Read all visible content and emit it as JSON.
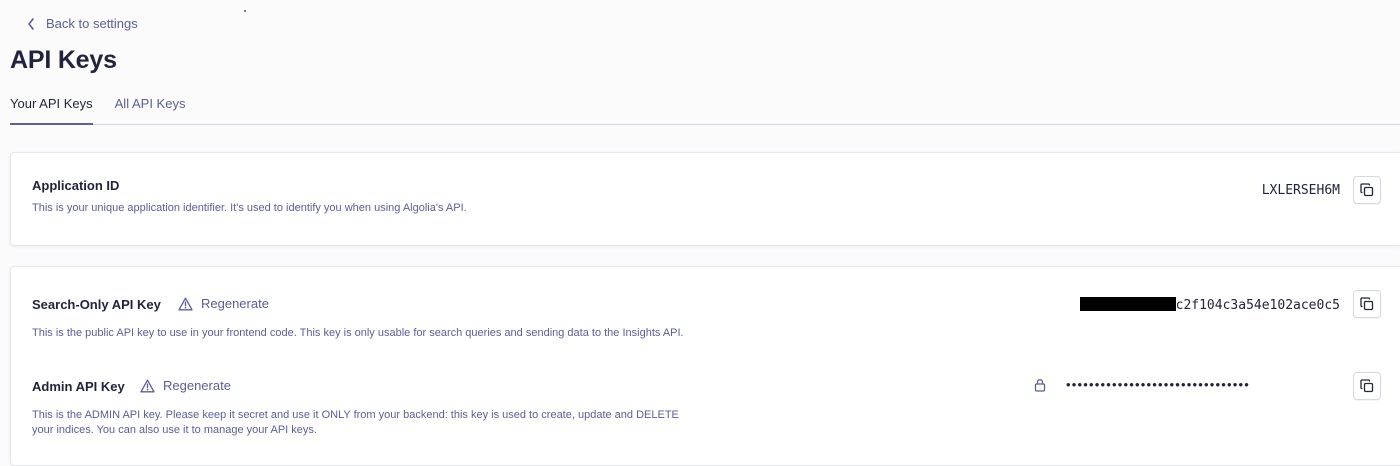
{
  "nav": {
    "back_label": "Back to settings"
  },
  "page": {
    "title": "API Keys"
  },
  "tabs": [
    {
      "label": "Your API Keys",
      "active": true
    },
    {
      "label": "All API Keys",
      "active": false
    }
  ],
  "application": {
    "label": "Application ID",
    "description": "This is your unique application identifier. It's used to identify you when using Algolia's API.",
    "value": "LXLERSEH6M"
  },
  "search_key": {
    "label": "Search-Only API Key",
    "regenerate_label": "Regenerate",
    "description": "This is the public API key to use in your frontend code. This key is only usable for search queries and sending data to the Insights API.",
    "value_visible": "c2f104c3a54e102ace0c5"
  },
  "admin_key": {
    "label": "Admin API Key",
    "regenerate_label": "Regenerate",
    "description_line1": "This is the ADMIN API key. Please keep it secret and use it ONLY from your backend: this key is used to create, update and DELETE",
    "description_line2": "your indices. You can also use it to manage your API keys.",
    "masked_value": "••••••••••••••••••••••••••••••••"
  },
  "colors": {
    "text": "#23263b",
    "muted": "#5a5e9a",
    "border": "#d6d6e7",
    "background": "#fbfbfc"
  },
  "icons": {
    "back": "chevron-left-icon",
    "regenerate": "warning-triangle-icon",
    "copy": "copy-icon",
    "lock": "lock-icon"
  }
}
